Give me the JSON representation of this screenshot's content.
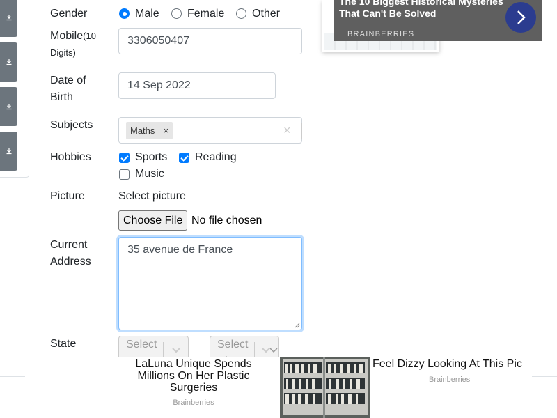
{
  "form": {
    "gender": {
      "label": "Gender",
      "options": [
        "Male",
        "Female",
        "Other"
      ],
      "selected": "Male"
    },
    "mobile": {
      "label": "Mobile",
      "hint": "(10 Digits)",
      "value": "3306050407"
    },
    "dob": {
      "label_line1": "Date of",
      "label_line2": "Birth",
      "value": "14 Sep 2022"
    },
    "subjects": {
      "label": "Subjects",
      "chips": [
        "Maths"
      ],
      "chip_remove": "×",
      "clear": "×"
    },
    "hobbies": {
      "label": "Hobbies",
      "options": [
        {
          "label": "Sports",
          "checked": true
        },
        {
          "label": "Reading",
          "checked": true
        },
        {
          "label": "Music",
          "checked": false
        }
      ]
    },
    "picture": {
      "label": "Picture",
      "prompt": "Select picture",
      "button": "Choose File",
      "status": "No file chosen"
    },
    "address": {
      "label_line1": "Current",
      "label_line2": "Address",
      "value": "35 avenue de France"
    },
    "state": {
      "label": "State",
      "state_placeholder": "Select State",
      "city_placeholder": "Select City"
    }
  },
  "ads": {
    "top": {
      "title": "The 10 Biggest Historical Mysteries That Can't Be Solved",
      "brand": "BRAINBERRIES",
      "background": "#5f5f5f",
      "arrow_color": "#2b3c8f"
    },
    "bottom": {
      "left_title": "LaLuna Unique Spends Millions On Her Plastic Surgeries",
      "left_brand": "Brainberries",
      "right_title": "Feel Dizzy Looking At This Pic",
      "right_brand": "Brainberries"
    }
  },
  "sidebar": {
    "download_icons": [
      "download-icon",
      "download-icon",
      "download-icon",
      "download-icon"
    ]
  },
  "colors": {
    "accent": "#007bff",
    "sidebar_button": "#6c757d",
    "focus_border": "#80bdff"
  }
}
